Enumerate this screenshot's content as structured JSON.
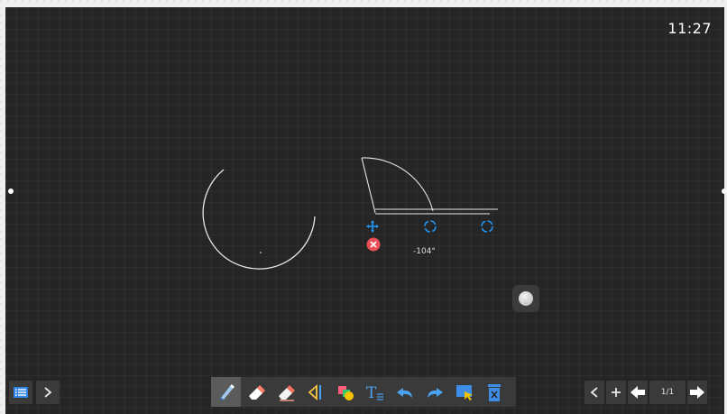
{
  "status": {
    "clock": "11:27"
  },
  "canvas": {
    "protractor_angle": "-104°"
  },
  "page": {
    "indicator": "1/1"
  },
  "toolbar": {
    "items": [
      "pen",
      "eraser",
      "clear-eraser",
      "select",
      "shapes",
      "text",
      "undo",
      "redo",
      "screenshot",
      "delete"
    ]
  },
  "colors": {
    "board": "#252525",
    "accent_blue": "#2196f3",
    "close_red": "#e84f57"
  },
  "icons": {
    "left": [
      "menu-list-icon",
      "chevron-right-icon"
    ],
    "right": [
      "chevron-left-icon",
      "plus-icon",
      "prev-page-arrow-icon",
      "next-page-arrow-icon"
    ]
  }
}
